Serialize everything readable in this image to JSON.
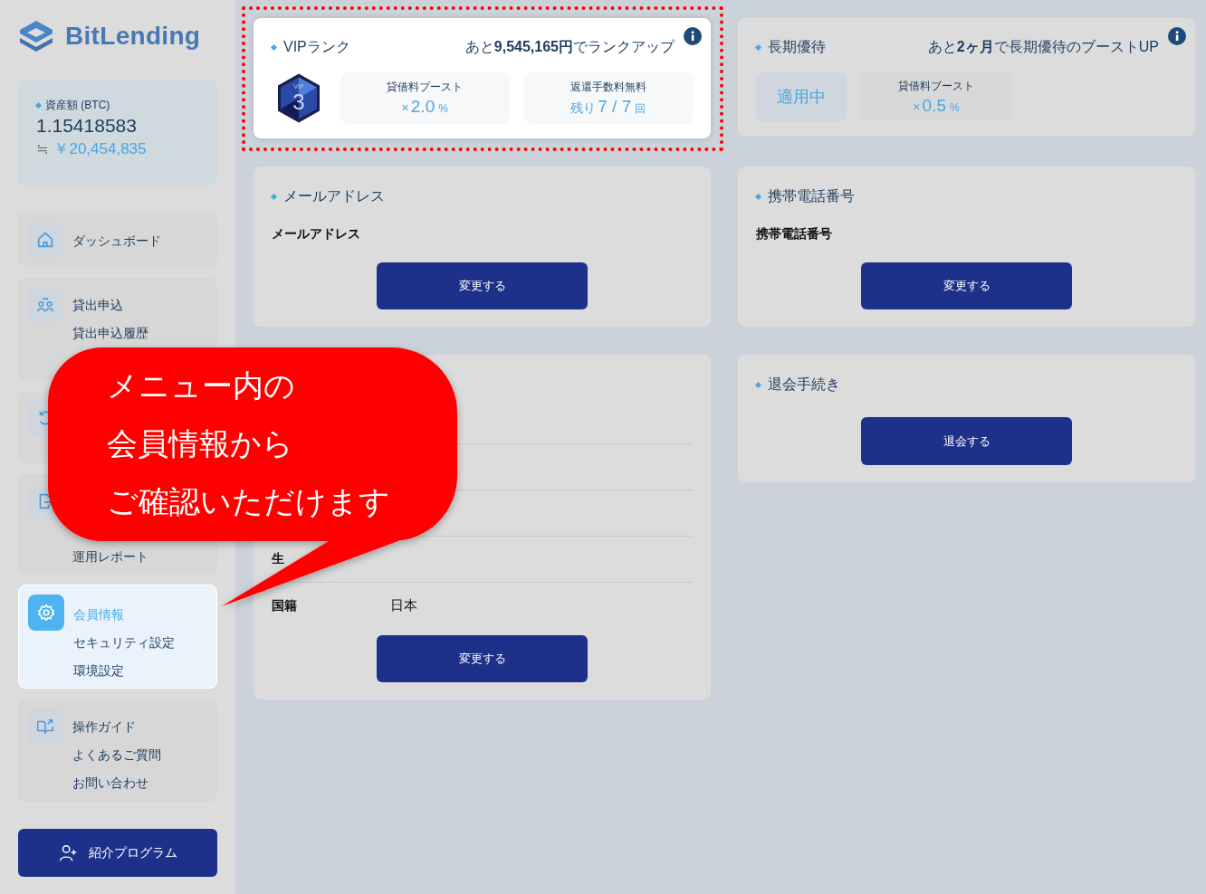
{
  "logo": {
    "text": "BitLending"
  },
  "assets": {
    "label": "資産額 (BTC)",
    "amount": "1.15418583",
    "approx": "≒",
    "yen": "￥20,454,835"
  },
  "nav": [
    {
      "selected": false,
      "items": [
        {
          "label": "ダッシュボード",
          "selected": false
        }
      ]
    },
    {
      "selected": false,
      "items": [
        {
          "label": "貸出申込",
          "selected": false
        },
        {
          "label": "貸出申込履歴",
          "selected": false
        }
      ]
    },
    {
      "selected": false
    },
    {
      "selected": false,
      "items": [
        {
          "label": "運用レポート",
          "selected": false
        }
      ]
    },
    {
      "selected": true,
      "items": [
        {
          "label": "会員情報",
          "selected": true
        },
        {
          "label": "セキュリティ設定",
          "selected": false
        },
        {
          "label": "環境設定",
          "selected": false
        }
      ]
    },
    {
      "selected": false,
      "items": [
        {
          "label": "操作ガイド",
          "selected": false
        },
        {
          "label": "よくあるご質問",
          "selected": false
        },
        {
          "label": "お問い合わせ",
          "selected": false
        }
      ]
    }
  ],
  "referral_button": "紹介プログラム",
  "vip": {
    "title": "VIPランク",
    "note": "あと**9,545,165円**でランクアップ",
    "badge": {
      "label": "VIP",
      "rank": "3"
    },
    "boxes": [
      {
        "label": "貸借料ブースト",
        "prefix": "×",
        "main": "2.0",
        "suffix": "%"
      },
      {
        "label": "返還手数料無料",
        "prefix": "残り",
        "main": "7 / 7",
        "suffix": "回"
      }
    ]
  },
  "long_term": {
    "title": "長期優待",
    "note": "あと**2ヶ月**で長期優待のブーストUP",
    "status": "適用中",
    "boxes": [
      {
        "label": "貸借料ブースト",
        "prefix": "×",
        "main": "0.5",
        "suffix": "%"
      }
    ]
  },
  "email": {
    "title": "メールアドレス",
    "label": "メールアドレス",
    "button": "変更する"
  },
  "phone": {
    "title": "携帯電話番号",
    "label": "携帯電話番号",
    "button": "変更する"
  },
  "personal": {
    "rows": [
      {
        "label": "生"
      },
      {
        "label": "国籍",
        "value": "日本"
      }
    ],
    "button": "変更する"
  },
  "withdraw": {
    "title": "退会手続き",
    "button": "退会する"
  },
  "callout": {
    "lines": [
      "メニュー内の",
      "会員情報から",
      "ご確認いただけます"
    ]
  }
}
